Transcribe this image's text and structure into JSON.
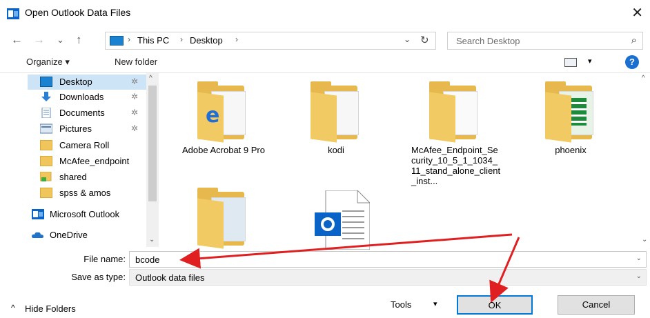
{
  "window": {
    "title": "Open Outlook Data Files",
    "close_glyph": "✕"
  },
  "nav": {
    "back_glyph": "←",
    "forward_glyph": "→",
    "recent_glyph": "⌄",
    "up_glyph": "↑",
    "breadcrumbs": [
      "This PC",
      "Desktop"
    ],
    "crumb_sep": "›",
    "address_drop_glyph": "⌄",
    "refresh_glyph": "↻",
    "search_placeholder": "Search Desktop",
    "search_glyph": "⌕"
  },
  "toolbar": {
    "organize_label": "Organize ▾",
    "new_folder_label": "New folder",
    "help_glyph": "?",
    "view_drop_glyph": "▾"
  },
  "sidebar": {
    "items": [
      {
        "label": "Desktop",
        "icon": "desktop-icon",
        "pinned": true
      },
      {
        "label": "Downloads",
        "icon": "downloads-icon",
        "pinned": true
      },
      {
        "label": "Documents",
        "icon": "documents-icon",
        "pinned": true
      },
      {
        "label": "Pictures",
        "icon": "pictures-icon",
        "pinned": true
      },
      {
        "label": "Camera Roll",
        "icon": "folder-icon",
        "pinned": false
      },
      {
        "label": "McAfee_endpoint",
        "icon": "folder-icon",
        "pinned": false
      },
      {
        "label": "shared",
        "icon": "shared-folder-icon",
        "pinned": false
      },
      {
        "label": "spss & amos",
        "icon": "folder-icon",
        "pinned": false
      },
      {
        "label": "Microsoft Outlook",
        "icon": "outlook-icon",
        "pinned": false
      },
      {
        "label": "OneDrive",
        "icon": "onedrive-icon",
        "pinned": false
      }
    ],
    "pin_glyph": "✲",
    "scroll_up_glyph": "^",
    "scroll_down_glyph": "⌄"
  },
  "files": [
    {
      "name": "Adobe Acrobat 9 Pro",
      "icon": "folder-icon"
    },
    {
      "name": "kodi",
      "icon": "folder-icon"
    },
    {
      "name": "McAfee_Endpoint_Security_10_5_1_1034_11_stand_alone_client_inst...",
      "icon": "folder-icon"
    },
    {
      "name": "phoenix",
      "icon": "folder-icon"
    },
    {
      "name": "",
      "icon": "folder-icon"
    },
    {
      "name": "",
      "icon": "outlook-data-file-icon"
    }
  ],
  "form": {
    "file_name_label": "File name:",
    "file_name_value": "bcode",
    "save_type_label": "Save as type:",
    "save_type_value": "Outlook data files"
  },
  "bottom": {
    "hide_folders_label": "Hide Folders",
    "tools_label": "Tools",
    "ok_label": "OK",
    "cancel_label": "Cancel"
  },
  "colors": {
    "accent": "#0078d7",
    "annotation": "#e02020",
    "folder": "#e6b84e",
    "selected": "#cde3f6"
  }
}
